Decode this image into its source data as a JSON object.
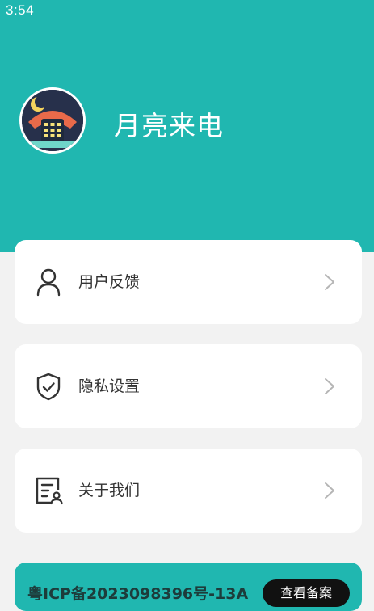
{
  "status_bar": {
    "time": "3:54"
  },
  "header": {
    "app_title": "月亮来电",
    "avatar_icon": "moon-phone-icon"
  },
  "menu": {
    "items": [
      {
        "label": "用户反馈",
        "icon": "user-icon"
      },
      {
        "label": "隐私设置",
        "icon": "shield-check-icon"
      },
      {
        "label": "关于我们",
        "icon": "profile-card-icon"
      }
    ]
  },
  "icp": {
    "text": "粤ICP备2023098396号-13A",
    "button_label": "查看备案"
  },
  "colors": {
    "accent": "#20b7b0",
    "background": "#f2f2f2",
    "card": "#ffffff"
  }
}
